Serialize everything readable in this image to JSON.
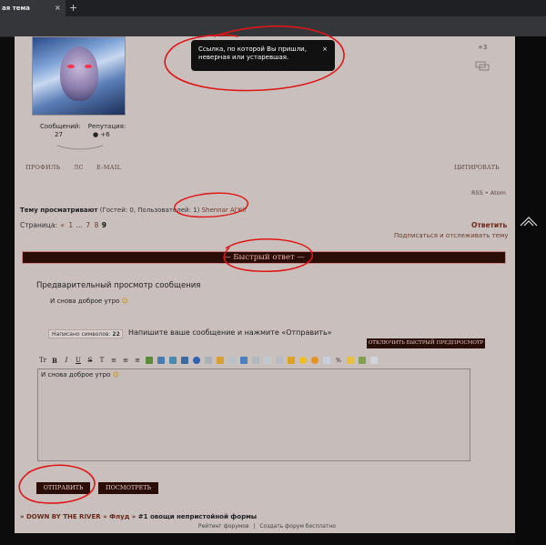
{
  "browser": {
    "tab_title": "ая тема",
    "tab_close": "×",
    "new_tab": "+"
  },
  "post": {
    "stats_label_messages": "Сообщений:",
    "stats_label_rep": "Репутация:",
    "messages_count": "27",
    "rep_value": "+6",
    "links": [
      "ПРОФИЛЬ",
      "ЛС",
      "E-MAIL"
    ],
    "quote_label": "ЦИТИРОВАТЬ",
    "rep_plus": "+3"
  },
  "tooltip": {
    "text_line1": "Ссылка, по которой Вы пришли,",
    "text_line2": "неверная или устаревшая.",
    "close": "×"
  },
  "feeds": {
    "rss": "RSS",
    "sep": "•",
    "atom": "Atom"
  },
  "viewing": {
    "label": "Тему просматривают",
    "info": "(Гостей: 0, Пользователей: 1)",
    "user": "Shennar Al'Kir"
  },
  "pagination": {
    "label": "Страница:",
    "prev": "«",
    "p1": "1",
    "ellipsis": "…",
    "p7": "7",
    "p8": "8",
    "current": "9"
  },
  "actions": {
    "reply": "Ответить",
    "subscribe": "Подписаться и отслеживать тему"
  },
  "quick_reply": {
    "title": "— Быстрый ответ —",
    "preview_heading": "Предварительный просмотр сообщения",
    "preview_text": "И снова доброе утро",
    "counter_label": "Написано символов:",
    "counter_value": "22",
    "hint": "Напишите ваше сообщение и нажмите «Отправить»",
    "toggle_preview": "ОТКЛЮЧИТЬ БЫСТРЫЙ ПРЕДПРОСМОТР",
    "textarea_value": "И снова доброе утро",
    "send_button": "ОТПРАВИТЬ",
    "view_button": "ПОСМОТРЕТЬ",
    "toolbar": {
      "font": "Tr",
      "bold": "B",
      "italic": "I",
      "underline": "U",
      "strike": "S",
      "clear": "T"
    }
  },
  "breadcrumb": {
    "prefix": "»",
    "forum": "DOWN BY THE RIVER",
    "sep": "»",
    "section": "Флуд",
    "topic": "#1 овощи непристойной формы"
  },
  "footer": {
    "rating": "Рейтинг форумов",
    "sep": "|",
    "create": "Создать форум бесплатно"
  },
  "colors": {
    "accent": "#6b2b1c",
    "bar": "#2b0d08",
    "page_bg": "#c9bfbc",
    "annotation": "#e01515"
  }
}
